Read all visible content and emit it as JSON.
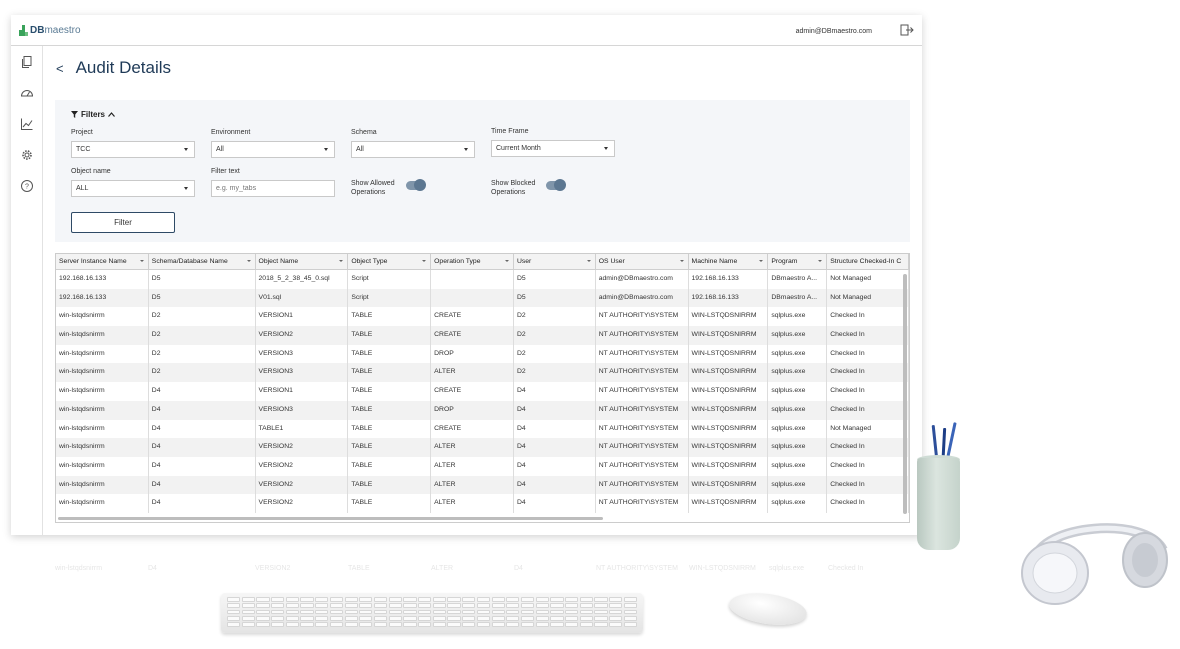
{
  "brand": {
    "logo_bold": "DB",
    "logo_light": "maestro"
  },
  "header": {
    "user_email": "admin@DBmaestro.com"
  },
  "sidebar": {
    "items": [
      {
        "name": "copy-icon"
      },
      {
        "name": "dashboard-gauge-icon"
      },
      {
        "name": "analytics-chart-icon"
      },
      {
        "name": "settings-gear-icon"
      },
      {
        "name": "help-icon"
      }
    ]
  },
  "page": {
    "back_glyph": "<",
    "title": "Audit Details"
  },
  "filters": {
    "toggle_label": "Filters",
    "project": {
      "label": "Project",
      "value": "TCC"
    },
    "environment": {
      "label": "Environment",
      "value": "All"
    },
    "schema": {
      "label": "Schema",
      "value": "All"
    },
    "time_frame": {
      "label": "Time Frame",
      "value": "Current Month"
    },
    "object_name": {
      "label": "Object name",
      "value": "ALL"
    },
    "filter_text": {
      "label": "Filter text",
      "placeholder": "e.g. my_tabs"
    },
    "show_allowed": {
      "label_line1": "Show Allowed",
      "label_line2": "Operations",
      "on": true
    },
    "show_blocked": {
      "label_line1": "Show Blocked",
      "label_line2": "Operations",
      "on": true
    },
    "filter_button": "Filter"
  },
  "table": {
    "columns": [
      "Server Instance Name",
      "Schema/Database Name",
      "Object Name",
      "Object Type",
      "Operation Type",
      "User",
      "OS User",
      "Machine Name",
      "Program",
      "Structure Checked-In C"
    ],
    "rows": [
      [
        "192.168.16.133",
        "D5",
        "2018_5_2_38_45_0.sql",
        "Script",
        "",
        "D5",
        "admin@DBmaestro.com",
        "192.168.16.133",
        "DBmaestro A...",
        "Not Managed"
      ],
      [
        "192.168.16.133",
        "D5",
        "V01.sql",
        "Script",
        "",
        "D5",
        "admin@DBmaestro.com",
        "192.168.16.133",
        "DBmaestro A...",
        "Not Managed"
      ],
      [
        "win-lstqdsnirrm",
        "D2",
        "VERSION1",
        "TABLE",
        "CREATE",
        "D2",
        "NT AUTHORITY\\SYSTEM",
        "WIN-LSTQDSNIRRM",
        "sqlplus.exe",
        "Checked In"
      ],
      [
        "win-lstqdsnirrm",
        "D2",
        "VERSION2",
        "TABLE",
        "CREATE",
        "D2",
        "NT AUTHORITY\\SYSTEM",
        "WIN-LSTQDSNIRRM",
        "sqlplus.exe",
        "Checked In"
      ],
      [
        "win-lstqdsnirrm",
        "D2",
        "VERSION3",
        "TABLE",
        "DROP",
        "D2",
        "NT AUTHORITY\\SYSTEM",
        "WIN-LSTQDSNIRRM",
        "sqlplus.exe",
        "Checked In"
      ],
      [
        "win-lstqdsnirrm",
        "D2",
        "VERSION3",
        "TABLE",
        "ALTER",
        "D2",
        "NT AUTHORITY\\SYSTEM",
        "WIN-LSTQDSNIRRM",
        "sqlplus.exe",
        "Checked In"
      ],
      [
        "win-lstqdsnirrm",
        "D4",
        "VERSION1",
        "TABLE",
        "CREATE",
        "D4",
        "NT AUTHORITY\\SYSTEM",
        "WIN-LSTQDSNIRRM",
        "sqlplus.exe",
        "Checked In"
      ],
      [
        "win-lstqdsnirrm",
        "D4",
        "VERSION3",
        "TABLE",
        "DROP",
        "D4",
        "NT AUTHORITY\\SYSTEM",
        "WIN-LSTQDSNIRRM",
        "sqlplus.exe",
        "Checked In"
      ],
      [
        "win-lstqdsnirrm",
        "D4",
        "TABLE1",
        "TABLE",
        "CREATE",
        "D4",
        "NT AUTHORITY\\SYSTEM",
        "WIN-LSTQDSNIRRM",
        "sqlplus.exe",
        "Not Managed"
      ],
      [
        "win-lstqdsnirrm",
        "D4",
        "VERSION2",
        "TABLE",
        "ALTER",
        "D4",
        "NT AUTHORITY\\SYSTEM",
        "WIN-LSTQDSNIRRM",
        "sqlplus.exe",
        "Checked In"
      ],
      [
        "win-lstqdsnirrm",
        "D4",
        "VERSION2",
        "TABLE",
        "ALTER",
        "D4",
        "NT AUTHORITY\\SYSTEM",
        "WIN-LSTQDSNIRRM",
        "sqlplus.exe",
        "Checked In"
      ],
      [
        "win-lstqdsnirrm",
        "D4",
        "VERSION2",
        "TABLE",
        "ALTER",
        "D4",
        "NT AUTHORITY\\SYSTEM",
        "WIN-LSTQDSNIRRM",
        "sqlplus.exe",
        "Checked In"
      ],
      [
        "win-lstqdsnirrm",
        "D4",
        "VERSION2",
        "TABLE",
        "ALTER",
        "D4",
        "NT AUTHORITY\\SYSTEM",
        "WIN-LSTQDSNIRRM",
        "sqlplus.exe",
        "Checked In"
      ]
    ]
  },
  "colors": {
    "accent": "#1f3a57",
    "toggle_on": "#5c7791",
    "logo_green": "#3aa35b",
    "panel_bg": "#f4f6f9"
  }
}
